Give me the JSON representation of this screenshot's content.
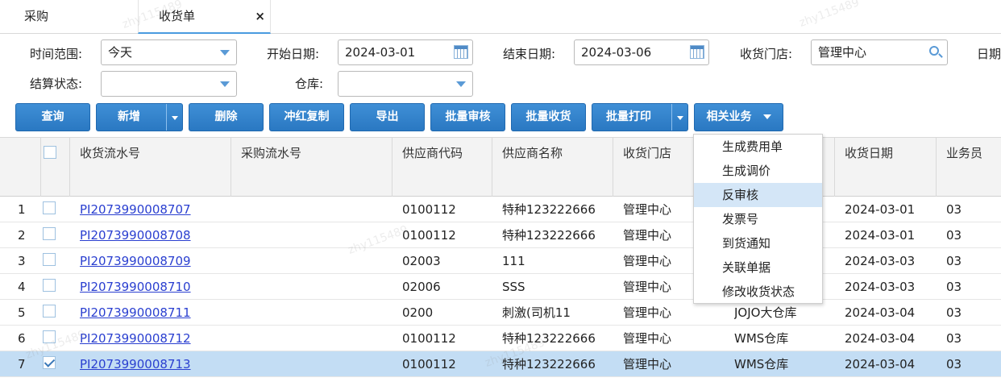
{
  "tabs": [
    {
      "label": "采购"
    },
    {
      "label": "收货单",
      "close": "×"
    }
  ],
  "watermark": "zhy115489",
  "form": {
    "time_range_label": "时间范围:",
    "time_range_value": "今天",
    "start_date_label": "开始日期:",
    "start_date_value": "2024-03-01",
    "end_date_label": "结束日期:",
    "end_date_value": "2024-03-06",
    "store_label": "收货门店:",
    "store_value": "管理中心",
    "date_label": "日期",
    "settle_label": "结算状态:",
    "settle_value": "",
    "warehouse_label": "仓库:",
    "warehouse_value": ""
  },
  "toolbar": {
    "query": "查询",
    "add": "新增",
    "delete": "删除",
    "reverse_copy": "冲红复制",
    "export": "导出",
    "batch_audit": "批量审核",
    "batch_receive": "批量收货",
    "batch_print": "批量打印",
    "related": "相关业务"
  },
  "table": {
    "headers": [
      "收货流水号",
      "采购流水号",
      "供应商代码",
      "供应商名称",
      "收货门店",
      "收货日期",
      "业务员"
    ],
    "rows": [
      {
        "idx": "1",
        "checked": false,
        "receipt_no": "PI2073990008707",
        "purchase_no": "",
        "supplier_code": "0100112",
        "supplier_name": "特种123222666",
        "store": "管理中心",
        "warehouse": "",
        "date": "2024-03-01",
        "clerk": "03"
      },
      {
        "idx": "2",
        "checked": false,
        "receipt_no": "PI2073990008708",
        "purchase_no": "",
        "supplier_code": "0100112",
        "supplier_name": "特种123222666",
        "store": "管理中心",
        "warehouse": "",
        "date": "2024-03-01",
        "clerk": "03"
      },
      {
        "idx": "3",
        "checked": false,
        "receipt_no": "PI2073990008709",
        "purchase_no": "",
        "supplier_code": "02003",
        "supplier_name": "111",
        "store": "管理中心",
        "warehouse": "",
        "date": "2024-03-03",
        "clerk": "03"
      },
      {
        "idx": "4",
        "checked": false,
        "receipt_no": "PI2073990008710",
        "purchase_no": "",
        "supplier_code": "02006",
        "supplier_name": "SSS",
        "store": "管理中心",
        "warehouse": "",
        "date": "2024-03-03",
        "clerk": "03"
      },
      {
        "idx": "5",
        "checked": false,
        "receipt_no": "PI2073990008711",
        "purchase_no": "",
        "supplier_code": "0200",
        "supplier_name": "刺激(司机11",
        "store": "管理中心",
        "warehouse": "JOJO大仓库",
        "date": "2024-03-04",
        "clerk": "03"
      },
      {
        "idx": "6",
        "checked": false,
        "receipt_no": "PI2073990008712",
        "purchase_no": "",
        "supplier_code": "0100112",
        "supplier_name": "特种123222666",
        "store": "管理中心",
        "warehouse": "WMS仓库",
        "date": "2024-03-04",
        "clerk": "03"
      },
      {
        "idx": "7",
        "checked": true,
        "receipt_no": "PI2073990008713",
        "purchase_no": "",
        "supplier_code": "0100112",
        "supplier_name": "特种123222666",
        "store": "管理中心",
        "warehouse": "WMS仓库",
        "date": "2024-03-04",
        "clerk": "03"
      }
    ]
  },
  "related_menu": {
    "items": [
      "生成费用单",
      "生成调价",
      "反审核",
      "发票号",
      "到货通知",
      "关联单据",
      "修改收货状态"
    ],
    "highlighted": "反审核"
  },
  "colors": {
    "button": "#2f82cc",
    "selected_row": "#c3ddf4",
    "link": "#2a3fd0",
    "menu_highlight": "#d4e6f7"
  }
}
